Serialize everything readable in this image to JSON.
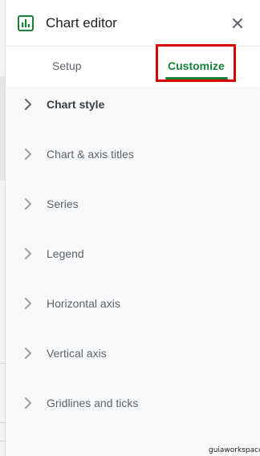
{
  "editor": {
    "title": "Chart editor",
    "tabs": {
      "setup": "Setup",
      "customize": "Customize"
    },
    "active_tab": "Customize",
    "sections": [
      {
        "label": "Chart style",
        "emphasis": "active"
      },
      {
        "label": "Chart & axis titles",
        "emphasis": "dim"
      },
      {
        "label": "Series",
        "emphasis": "dim"
      },
      {
        "label": "Legend",
        "emphasis": "dim"
      },
      {
        "label": "Horizontal axis",
        "emphasis": "dim"
      },
      {
        "label": "Vertical axis",
        "emphasis": "dim"
      },
      {
        "label": "Gridlines and ticks",
        "emphasis": "dim"
      }
    ]
  },
  "icons": {
    "title_icon": "bar-chart-icon",
    "close_icon": "close-icon",
    "section_icon": "chevron-right-icon"
  },
  "colors": {
    "accent": "#188038",
    "highlight_box": "#d60000",
    "body_background": "#f8f9fa"
  },
  "watermark": "guiaworkspace"
}
